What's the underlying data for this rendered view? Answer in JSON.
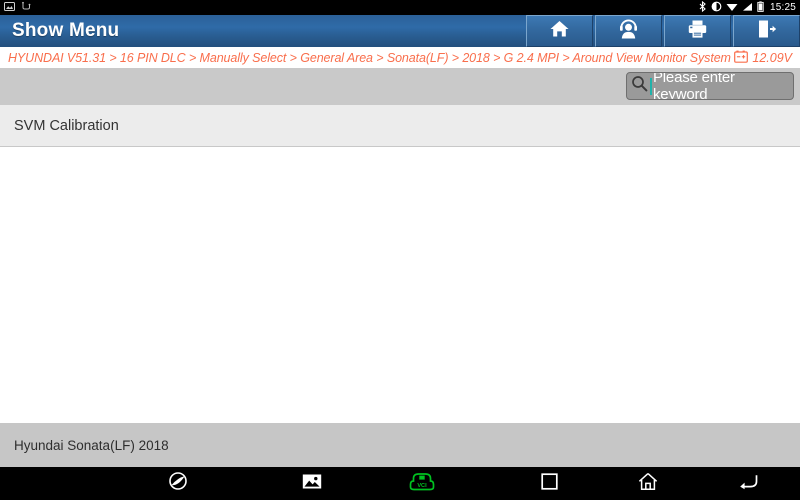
{
  "statusbar": {
    "time": "15:25",
    "left_icons": [
      "screenshot-icon",
      "usb-icon"
    ],
    "right_icons": [
      "bluetooth-icon",
      "dnd-icon",
      "wifi-icon",
      "signal-icon",
      "battery-icon"
    ]
  },
  "header": {
    "title": "Show Menu",
    "buttons": [
      {
        "name": "home-button",
        "icon": "home-icon"
      },
      {
        "name": "support-button",
        "icon": "headset-person-icon"
      },
      {
        "name": "print-button",
        "icon": "printer-icon"
      },
      {
        "name": "exit-button",
        "icon": "exit-door-icon"
      }
    ]
  },
  "breadcrumb": {
    "path": "HYUNDAI V51.31 > 16 PIN DLC > Manually Select > General Area > Sonata(LF) > 2018 > G 2.4 MPI > Around View Monitor System",
    "voltage": "12.09V",
    "voltage_icon": "car-battery-icon",
    "accent_color": "#f96e4c"
  },
  "search": {
    "placeholder": "Please enter keyword",
    "icon": "search-icon",
    "value": ""
  },
  "menu": {
    "items": [
      {
        "label": "SVM Calibration"
      }
    ]
  },
  "footer": {
    "vehicle": "Hyundai Sonata(LF) 2018"
  },
  "navbar": {
    "buttons": [
      {
        "name": "browser-button",
        "icon": "browser-globe-icon"
      },
      {
        "name": "gallery-button",
        "icon": "gallery-image-icon"
      },
      {
        "name": "vci-button",
        "icon": "vci-connector-icon",
        "label": "VCI",
        "color": "#00c221"
      },
      {
        "name": "recents-button",
        "icon": "square-recents-icon"
      },
      {
        "name": "home-button",
        "icon": "home-outline-icon"
      },
      {
        "name": "back-button",
        "icon": "back-arrow-icon"
      }
    ]
  }
}
